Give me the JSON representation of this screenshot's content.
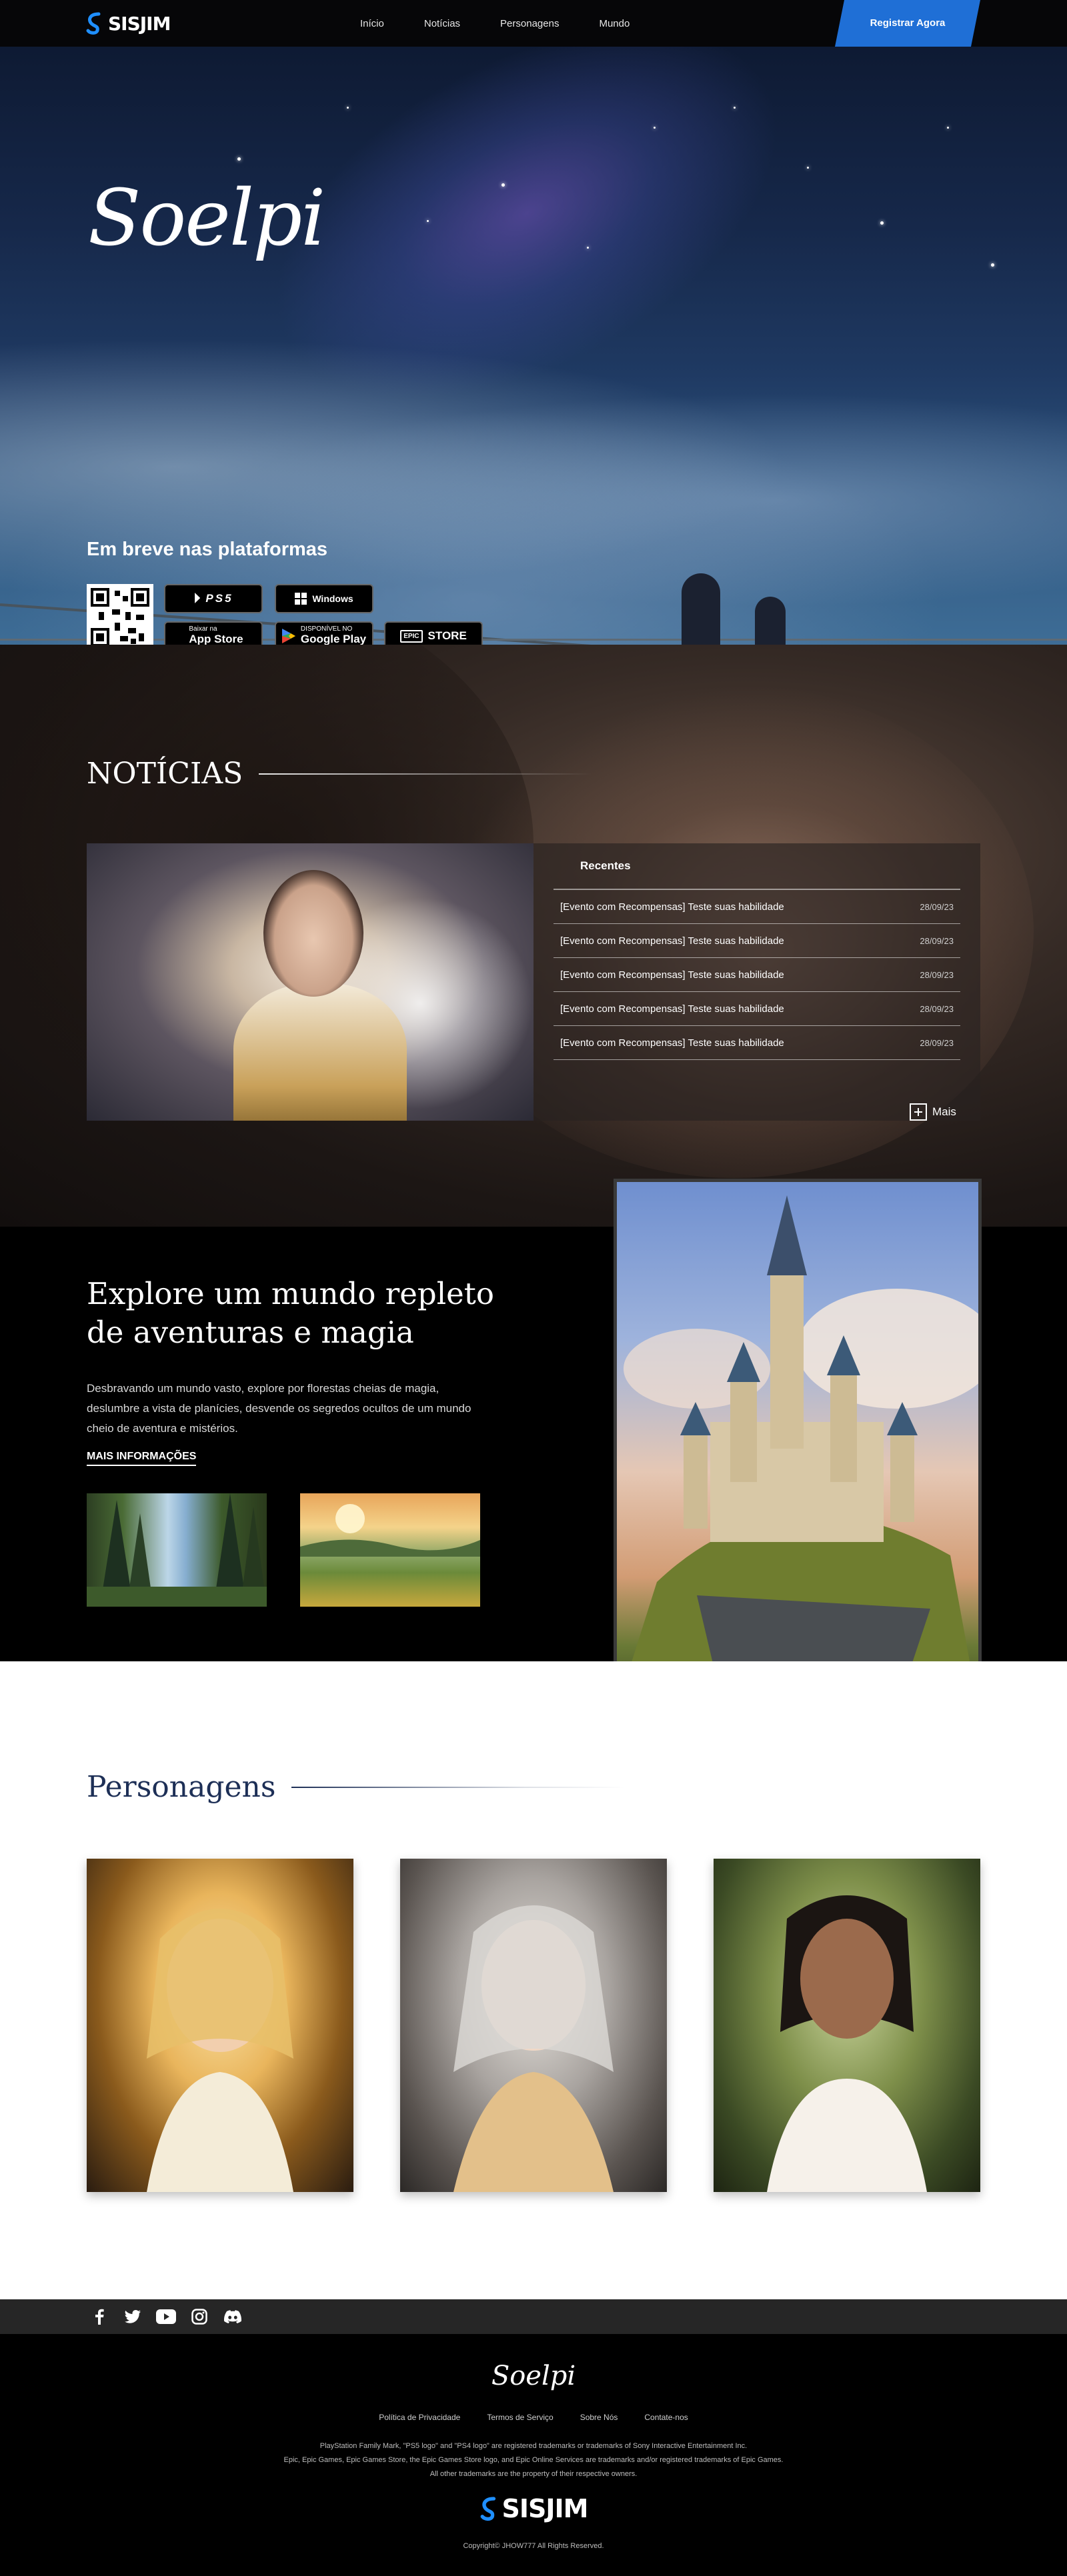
{
  "nav": {
    "brand": "SISJIM",
    "items": [
      "Início",
      "Notícias",
      "Personagens",
      "Mundo"
    ],
    "cta": "Registrar Agora"
  },
  "hero": {
    "game_logo": "Soelpi",
    "soon_text": "Em breve nas plataformas",
    "platforms": [
      {
        "label": "PS5",
        "icon": "playstation-icon"
      },
      {
        "label": "Windows",
        "icon": "windows-icon"
      },
      {
        "pre": "Baixar na",
        "label": "App Store",
        "icon": "apple-icon"
      },
      {
        "pre": "DISPONÍVEL NO",
        "label": "Google Play",
        "icon": "google-play-icon"
      },
      {
        "label": "STORE",
        "icon": "epic-games-icon"
      }
    ]
  },
  "news": {
    "title": "NOTÍCIAS",
    "list_header": "Recentes",
    "items": [
      {
        "title": "[Evento com Recompensas] Teste suas habilidade",
        "date": "28/09/23"
      },
      {
        "title": "[Evento com Recompensas] Teste suas habilidade",
        "date": "28/09/23"
      },
      {
        "title": "[Evento com Recompensas] Teste suas habilidade",
        "date": "28/09/23"
      },
      {
        "title": "[Evento com Recompensas] Teste suas habilidade",
        "date": "28/09/23"
      },
      {
        "title": "[Evento com Recompensas] Teste suas habilidade",
        "date": "28/09/23"
      }
    ],
    "more": "Mais"
  },
  "explore": {
    "heading": "Explore um mundo repleto de aventuras e magia",
    "body": "Desbravando um mundo vasto, explore por florestas cheias de magia, deslumbre a vista de planícies, desvende os segredos ocultos de um mundo cheio de aventura e mistérios.",
    "link": "MAIS INFORMAÇÕES"
  },
  "characters": {
    "title": "Personagens"
  },
  "social": [
    "facebook-icon",
    "twitter-icon",
    "youtube-icon",
    "instagram-icon",
    "discord-icon"
  ],
  "footer": {
    "game_logo": "Soelpi",
    "links": [
      "Política de Privacidade",
      "Termos de Serviço",
      "Sobre Nós",
      "Contate-nos"
    ],
    "legal": [
      "PlayStation Family Mark, \"PS5 logo\" and \"PS4 logo\" are registered trademarks or trademarks of Sony Interactive Entertainment Inc.",
      "Epic, Epic Games, Epic Games Store, the Epic Games Store logo, and Epic Online Services are trademarks and/or registered trademarks of Epic Games.",
      "All other trademarks are the property of their respective owners."
    ],
    "brand": "SISJIM",
    "copyright": "Copyright© JHOW777 All Rights Reserved."
  },
  "colors": {
    "accent_blue": "#1f6fd6",
    "nav_bg": "#060608",
    "title_navy": "#1d2f56"
  }
}
